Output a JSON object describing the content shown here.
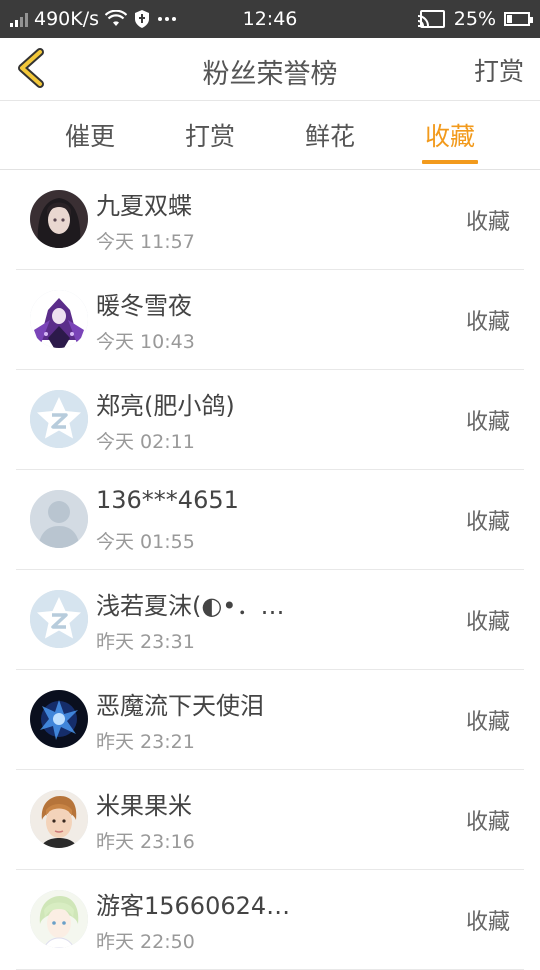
{
  "status_bar": {
    "net_speed": "490K/s",
    "time": "12:46",
    "battery": "25%",
    "battery_fraction": 0.25,
    "icons": [
      "signal-icon",
      "wifi-icon",
      "shield-icon",
      "more-dots-icon",
      "cast-icon",
      "battery-icon"
    ]
  },
  "nav": {
    "title": "粉丝荣誉榜",
    "action": "打赏",
    "back_icon": "chevron-left-icon",
    "accent": "#f29a1c"
  },
  "tabs": [
    {
      "label": "催更",
      "active": false
    },
    {
      "label": "打赏",
      "active": false
    },
    {
      "label": "鲜花",
      "active": false
    },
    {
      "label": "收藏",
      "active": true
    }
  ],
  "list": [
    {
      "name": "九夏双蝶",
      "time": "今天 11:57",
      "action": "收藏",
      "avatar": "anime-girl-dark-avatar"
    },
    {
      "name": "暖冬雪夜",
      "time": "今天 10:43",
      "action": "收藏",
      "avatar": "anime-purple-avatar"
    },
    {
      "name": "郑亮(肥小鸽)",
      "time": "今天 02:11",
      "action": "收藏",
      "avatar": "qq-star-default-avatar"
    },
    {
      "name": "136***4651",
      "time": "今天 01:55",
      "action": "收藏",
      "avatar": "person-silhouette-avatar"
    },
    {
      "name": "浅若夏沫(◐•．…",
      "time": "昨天 23:31",
      "action": "收藏",
      "avatar": "qq-star-default-avatar"
    },
    {
      "name": "恶魔流下天使泪",
      "time": "昨天 23:21",
      "action": "收藏",
      "avatar": "dark-blue-demon-avatar"
    },
    {
      "name": "米果果米",
      "time": "昨天 23:16",
      "action": "收藏",
      "avatar": "young-man-photo-avatar"
    },
    {
      "name": "游客15660624…",
      "time": "昨天 22:50",
      "action": "收藏",
      "avatar": "anime-boy-light-avatar"
    }
  ]
}
